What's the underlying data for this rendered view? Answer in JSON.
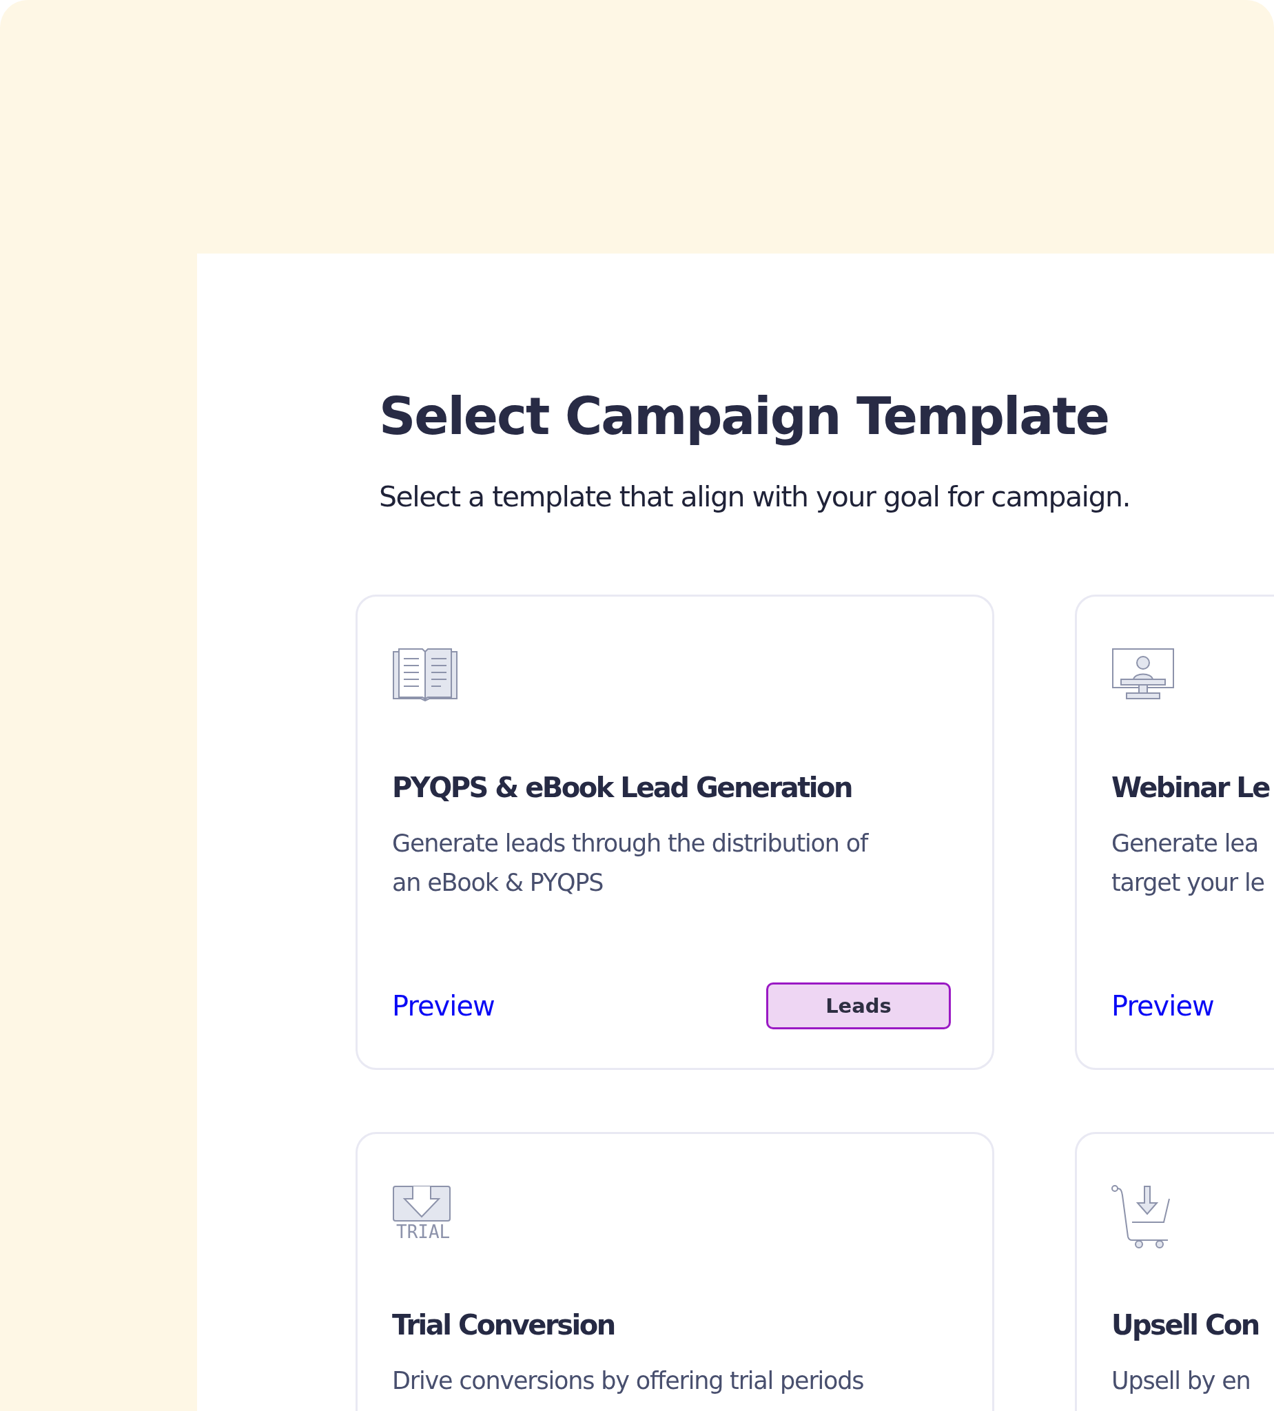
{
  "title": "Select Campaign Template",
  "subtitle": "Select a template that align with your goal for campaign.",
  "cards": [
    {
      "title": "PYQPS & eBook Lead Generation",
      "description_lines": [
        "Generate leads through the distribution of",
        "an eBook & PYQPS"
      ],
      "link": "Preview",
      "tag": "Leads"
    },
    {
      "title": "Webinar Le",
      "description_lines": [
        "Generate lea",
        "target your le"
      ],
      "link": "Preview"
    },
    {
      "title": "Trial Conversion",
      "icon_caption": "TRIAL",
      "description_lines": [
        "Drive conversions by offering trial periods"
      ]
    },
    {
      "title": "Upsell Con",
      "description_lines": [
        "Upsell by en"
      ]
    }
  ]
}
